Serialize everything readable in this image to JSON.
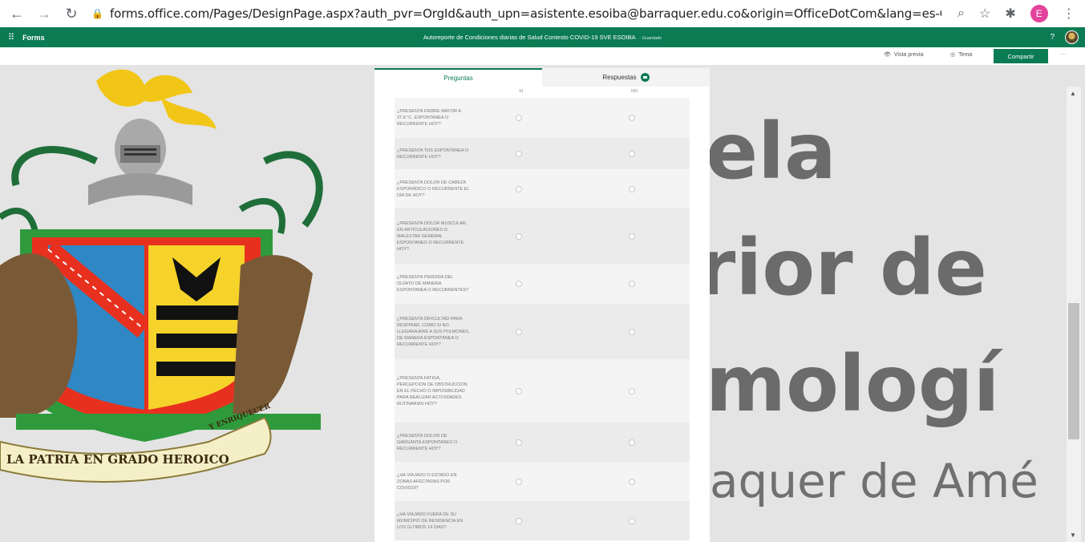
{
  "browser": {
    "url": "forms.office.com/Pages/DesignPage.aspx?auth_pvr=OrgId&auth_upn=asistente.esoiba@barraquer.edu.co&origin=OfficeDotCom&lang=es-CO#FormId=2FGcHEmHr0...",
    "profile_initial": "E"
  },
  "appbar": {
    "app_name": "Forms",
    "doc_title": "Autoreporte de Condiciones diarias de Salud Contesto COVID-19 SVE ESOIBA",
    "saved_status": "- Guardado",
    "help": "?"
  },
  "toolbar": {
    "preview": "Vista previa",
    "theme": "Tema",
    "share": "Compartir",
    "more": "···"
  },
  "tabs": {
    "questions": "Preguntas",
    "responses": "Respuestas"
  },
  "columns": {
    "yes": "SI",
    "no": "NO"
  },
  "questions": [
    "¿PRESENTA FIEBRE MAYOR A 37.8 °C, ESPONTANEA O RECURRENTE HOY?",
    "¿PRESENTA TOS ESPONTANEA O RECURRENTE HOY?",
    "¿PRESENTA DOLOR DE CABEZA ESPORÁDICO O RECURRENTE EL DÍA DE HOY?",
    "¿PRESENTA DOLOR MUSCULAR, EN ARTICULACIONES O MALESTAR GENERAL ESPONTANEO O RECURRENTE HOY?",
    "¿PRESENTA PERDIDA DEL OLFATO DE MANERA ESPONTANEA O RECURRENTES?",
    "¿PRESENTA DIFICULTAD PARA RESPIRAR, COMO SI NO LLEGARA AIRE A SUS PULMONES, DE MANERA ESPONTANEA O RECURRENTE HOY?",
    "¿PRESENTA FATIGA, PERCEPCION DE OBSTRUCCIÓN EN EL PECHO O IMPOSIBILIDAD PARA REALIZAR ACTIVIDADES RUTINARIAS HOY?",
    "¿PRESENTA DOLOR DE GARGANTA ESPONTANEO O RECURRENTE HOY?",
    "¿HA VIAJADO O ESTADO EN ZONAS AFECTADAS POR COVID19?",
    "¿HA VIAJADO FUERA DE SU MUNICIPIO DE RESIDENCIA EN LOS ÚLTIMOS 14 DIAS?"
  ],
  "background": {
    "crest_motto": "LA PATRIA EN GRADO HEROICO",
    "crest_ribbon": "Y ENRIQUECER",
    "line1": "ela",
    "line2": "rior de",
    "line3": "mologí",
    "line4": "aquer de Amé"
  },
  "colors": {
    "brand": "#0b7b54"
  }
}
